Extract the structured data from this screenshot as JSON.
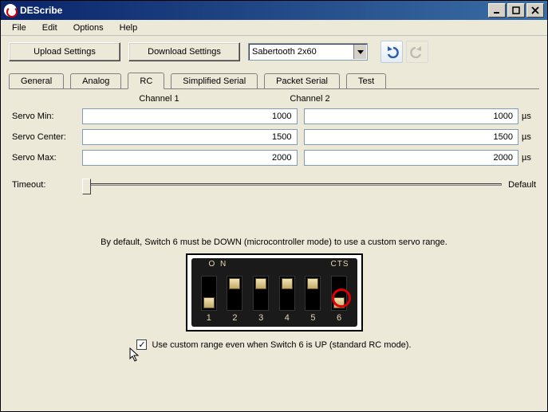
{
  "window": {
    "title": "DEScribe"
  },
  "menu": {
    "file": "File",
    "edit": "Edit",
    "options": "Options",
    "help": "Help"
  },
  "toolbar": {
    "upload_label": "Upload Settings",
    "download_label": "Download Settings",
    "device_selected": "Sabertooth 2x60"
  },
  "tabs": {
    "general": "General",
    "analog": "Analog",
    "rc": "RC",
    "simplified": "Simplified Serial",
    "packet": "Packet Serial",
    "test": "Test"
  },
  "headers": {
    "ch1": "Channel 1",
    "ch2": "Channel 2"
  },
  "labels": {
    "servo_min": "Servo Min:",
    "servo_center": "Servo Center:",
    "servo_max": "Servo Max:",
    "timeout": "Timeout:",
    "default": "Default"
  },
  "values": {
    "servo_min_ch1": "1000",
    "servo_min_ch2": "1000",
    "servo_center_ch1": "1500",
    "servo_center_ch2": "1500",
    "servo_max_ch1": "2000",
    "servo_max_ch2": "2000",
    "unit": "µs"
  },
  "info": {
    "hint": "By default, Switch 6 must be DOWN (microcontroller mode) to use a custom servo range.",
    "checkbox_label": "Use custom range even when Switch 6 is UP (standard RC mode)."
  },
  "dip": {
    "on": "O N",
    "cts": "CTS"
  }
}
